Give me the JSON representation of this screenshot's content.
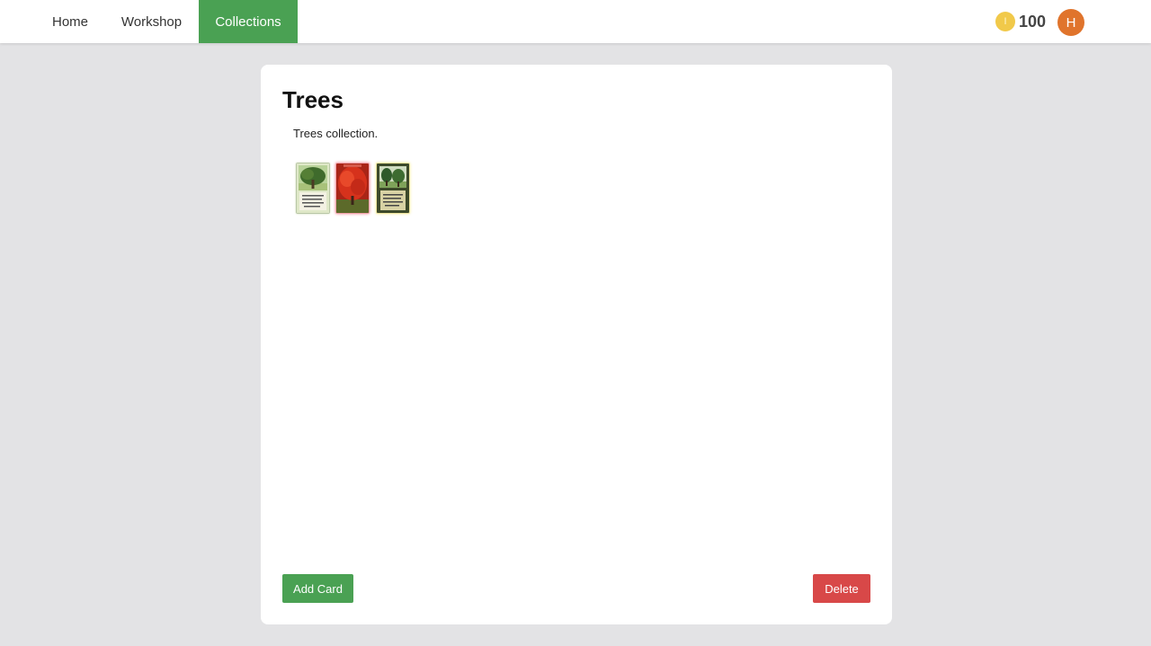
{
  "nav": {
    "items": [
      {
        "label": "Home"
      },
      {
        "label": "Workshop"
      },
      {
        "label": "Collections",
        "active": true
      }
    ]
  },
  "user": {
    "coin_icon": "coin-icon",
    "coin_glyph": "I",
    "coins": "100",
    "avatar_initial": "H"
  },
  "collection": {
    "title": "Trees",
    "description": "Trees collection.",
    "cards": [
      {
        "name": "green-oak-tree-card",
        "frame_color": "#c9d6ad"
      },
      {
        "name": "red-maple-tree-card",
        "frame_color": "#f28a96"
      },
      {
        "name": "park-trees-card",
        "frame_color": "#f5eb9e"
      }
    ]
  },
  "actions": {
    "add_label": "Add Card",
    "delete_label": "Delete"
  },
  "colors": {
    "accent_green": "#4aa153",
    "danger_red": "#d84848",
    "avatar_orange": "#e0742c",
    "coin_gold": "#f1c94a"
  }
}
